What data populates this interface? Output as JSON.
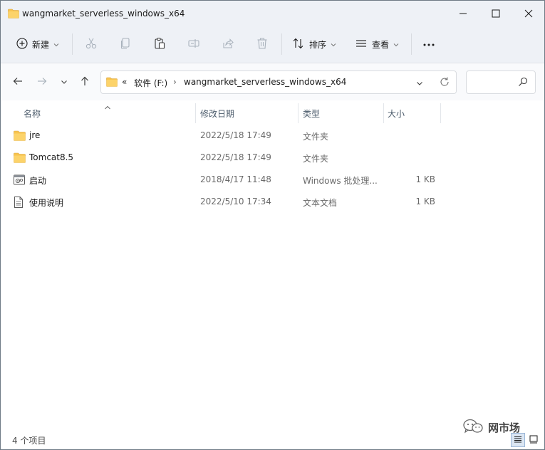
{
  "window": {
    "title": "wangmarket_serverless_windows_x64"
  },
  "toolbar": {
    "new_label": "新建",
    "sort_label": "排序",
    "view_label": "查看",
    "more_label": "···"
  },
  "address": {
    "overflow": "«",
    "crumbs": [
      "软件 (F:)",
      "wangmarket_serverless_windows_x64"
    ],
    "separator": "›",
    "search_placeholder": ""
  },
  "columns": {
    "name": "名称",
    "date": "修改日期",
    "type": "类型",
    "size": "大小"
  },
  "files": [
    {
      "name": "jre",
      "date": "2022/5/18 17:49",
      "type": "文件夹",
      "size": "",
      "icon": "folder-icon"
    },
    {
      "name": "Tomcat8.5",
      "date": "2022/5/18 17:49",
      "type": "文件夹",
      "size": "",
      "icon": "folder-icon"
    },
    {
      "name": "启动",
      "date": "2018/4/17 11:48",
      "type": "Windows 批处理...",
      "size": "1 KB",
      "icon": "batch-file-icon"
    },
    {
      "name": "使用说明",
      "date": "2022/5/10 17:34",
      "type": "文本文档",
      "size": "1 KB",
      "icon": "text-file-icon"
    }
  ],
  "status": {
    "item_count": "4 个项目"
  },
  "watermark": {
    "text": "网市场"
  },
  "colors": {
    "folder": "#f8c44f",
    "chrome": "#eef1f6",
    "border": "#6e7a85"
  }
}
